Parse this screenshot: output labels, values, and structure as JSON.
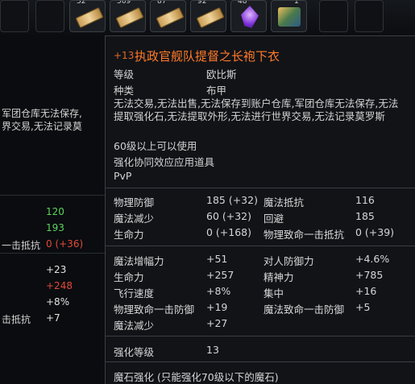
{
  "inventory_top": {
    "slots": [
      {
        "count": "32",
        "icon": "scroll-icon"
      },
      {
        "count": "569",
        "icon": "scroll-icon"
      },
      {
        "count": "87",
        "icon": "scroll-icon"
      },
      {
        "count": "92",
        "icon": "scroll-icon"
      },
      {
        "count": "48",
        "icon": "crystal-icon"
      },
      {
        "count": "1",
        "icon": "gem-icon"
      }
    ]
  },
  "left_panel": {
    "desc_line1": "军团仓库无法保存,",
    "desc_line2": "界交易,无法记录莫",
    "stats": [
      {
        "label": "",
        "value": "120",
        "color": "#5fd35f"
      },
      {
        "label": "",
        "value": "193",
        "color": "#5fd35f"
      },
      {
        "label": "一击抵抗",
        "value": "0 (+36)",
        "color": "#e14a3a"
      },
      {
        "label": "",
        "value": "+23",
        "color": "#e4e4e4"
      },
      {
        "label": "",
        "value": "+248",
        "color": "#e14a3a"
      },
      {
        "label": "",
        "value": "+8%",
        "color": "#e4e4e4"
      },
      {
        "label": "击抵抗",
        "value": "+7",
        "color": "#e4e4e4"
      }
    ]
  },
  "tooltip": {
    "enchant": "+13",
    "title": "执政官舰队提督之长袍下衣",
    "title_color": "#ff7a2a",
    "grade_label": "等级",
    "grade_value": "欧比斯",
    "type_label": "种类",
    "type_value": "布甲",
    "restrictions": "无法交易,无法出售,无法保存到账户仓库,军团仓库无法保存,无法提取强化石,无法提取外形,无法进行世界交易,无法记录莫罗斯",
    "level_req": "60级以上可以使用",
    "synergy": "强化协同效应应用道具",
    "pvp": "PvP",
    "base_stats": [
      {
        "label": "物理防御",
        "value": "185 (+32)"
      },
      {
        "label": "魔法抵抗",
        "value": "116"
      },
      {
        "label": "魔法减少",
        "value": "60 (+32)"
      },
      {
        "label": "回避",
        "value": "185"
      },
      {
        "label": "生命力",
        "value": "0 (+168)"
      },
      {
        "label": "物理致命一击抵抗",
        "value": "0 (+39)"
      }
    ],
    "bonus_stats": [
      {
        "label": "魔法增幅力",
        "value": "+51"
      },
      {
        "label": "对人防御力",
        "value": "+4.6%"
      },
      {
        "label": "生命力",
        "value": "+257"
      },
      {
        "label": "精神力",
        "value": "+785"
      },
      {
        "label": "飞行速度",
        "value": "+8%"
      },
      {
        "label": "集中",
        "value": "+16"
      },
      {
        "label": "物理致命一击防御",
        "value": "+19"
      },
      {
        "label": "魔法致命一击防御",
        "value": "+5"
      },
      {
        "label": "魔法减少",
        "value": "+27"
      }
    ],
    "enhance_label": "强化等级",
    "enhance_value": "13",
    "manastone": "魔石强化 (只能强化70级以下的魔石)"
  }
}
